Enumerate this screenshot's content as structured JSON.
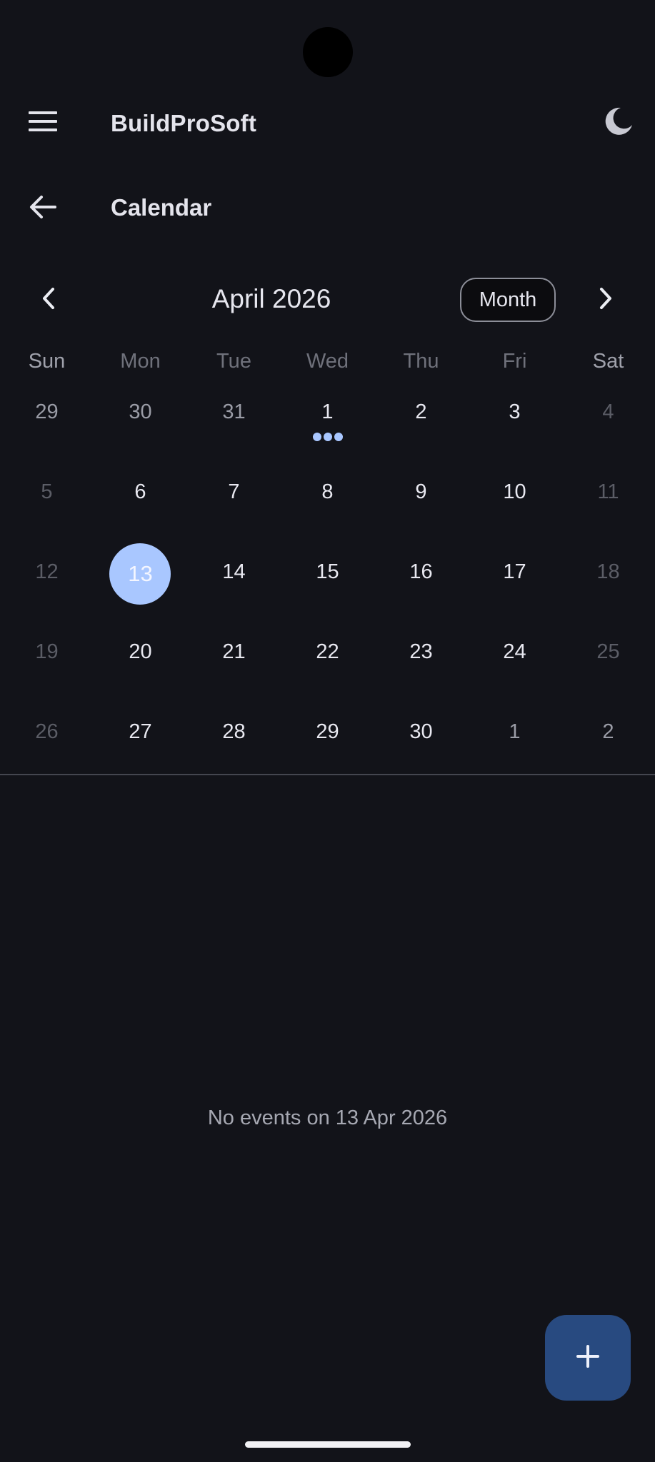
{
  "app": {
    "title": "BuildProSoft",
    "menu_icon": "menu-icon",
    "theme_icon": "moon-icon"
  },
  "page": {
    "title": "Calendar",
    "back_icon": "arrow-back-icon"
  },
  "calendar": {
    "month_label": "April 2026",
    "view_toggle_label": "Month",
    "prev_icon": "chevron-left-icon",
    "next_icon": "chevron-right-icon",
    "weekdays": [
      "Sun",
      "Mon",
      "Tue",
      "Wed",
      "Thu",
      "Fri",
      "Sat"
    ],
    "weeks": [
      [
        {
          "label": "29",
          "state": "other"
        },
        {
          "label": "30",
          "state": "other"
        },
        {
          "label": "31",
          "state": "other"
        },
        {
          "label": "1",
          "state": "normal",
          "events": 3
        },
        {
          "label": "2",
          "state": "normal"
        },
        {
          "label": "3",
          "state": "normal"
        },
        {
          "label": "4",
          "state": "weekend"
        }
      ],
      [
        {
          "label": "5",
          "state": "weekend"
        },
        {
          "label": "6",
          "state": "normal"
        },
        {
          "label": "7",
          "state": "normal"
        },
        {
          "label": "8",
          "state": "normal"
        },
        {
          "label": "9",
          "state": "normal"
        },
        {
          "label": "10",
          "state": "normal"
        },
        {
          "label": "11",
          "state": "weekend"
        }
      ],
      [
        {
          "label": "12",
          "state": "weekend"
        },
        {
          "label": "13",
          "state": "selected"
        },
        {
          "label": "14",
          "state": "normal"
        },
        {
          "label": "15",
          "state": "normal"
        },
        {
          "label": "16",
          "state": "normal"
        },
        {
          "label": "17",
          "state": "normal"
        },
        {
          "label": "18",
          "state": "weekend"
        }
      ],
      [
        {
          "label": "19",
          "state": "weekend"
        },
        {
          "label": "20",
          "state": "normal"
        },
        {
          "label": "21",
          "state": "normal"
        },
        {
          "label": "22",
          "state": "normal"
        },
        {
          "label": "23",
          "state": "normal"
        },
        {
          "label": "24",
          "state": "normal"
        },
        {
          "label": "25",
          "state": "weekend"
        }
      ],
      [
        {
          "label": "26",
          "state": "weekend"
        },
        {
          "label": "27",
          "state": "normal"
        },
        {
          "label": "28",
          "state": "normal"
        },
        {
          "label": "29",
          "state": "normal"
        },
        {
          "label": "30",
          "state": "normal"
        },
        {
          "label": "1",
          "state": "other"
        },
        {
          "label": "2",
          "state": "other"
        }
      ]
    ]
  },
  "events": {
    "empty_message": "No events on 13 Apr 2026"
  },
  "fab": {
    "icon": "plus-icon"
  },
  "colors": {
    "background": "#121319",
    "accent": "#a9c7ff",
    "fab": "#284a80"
  }
}
